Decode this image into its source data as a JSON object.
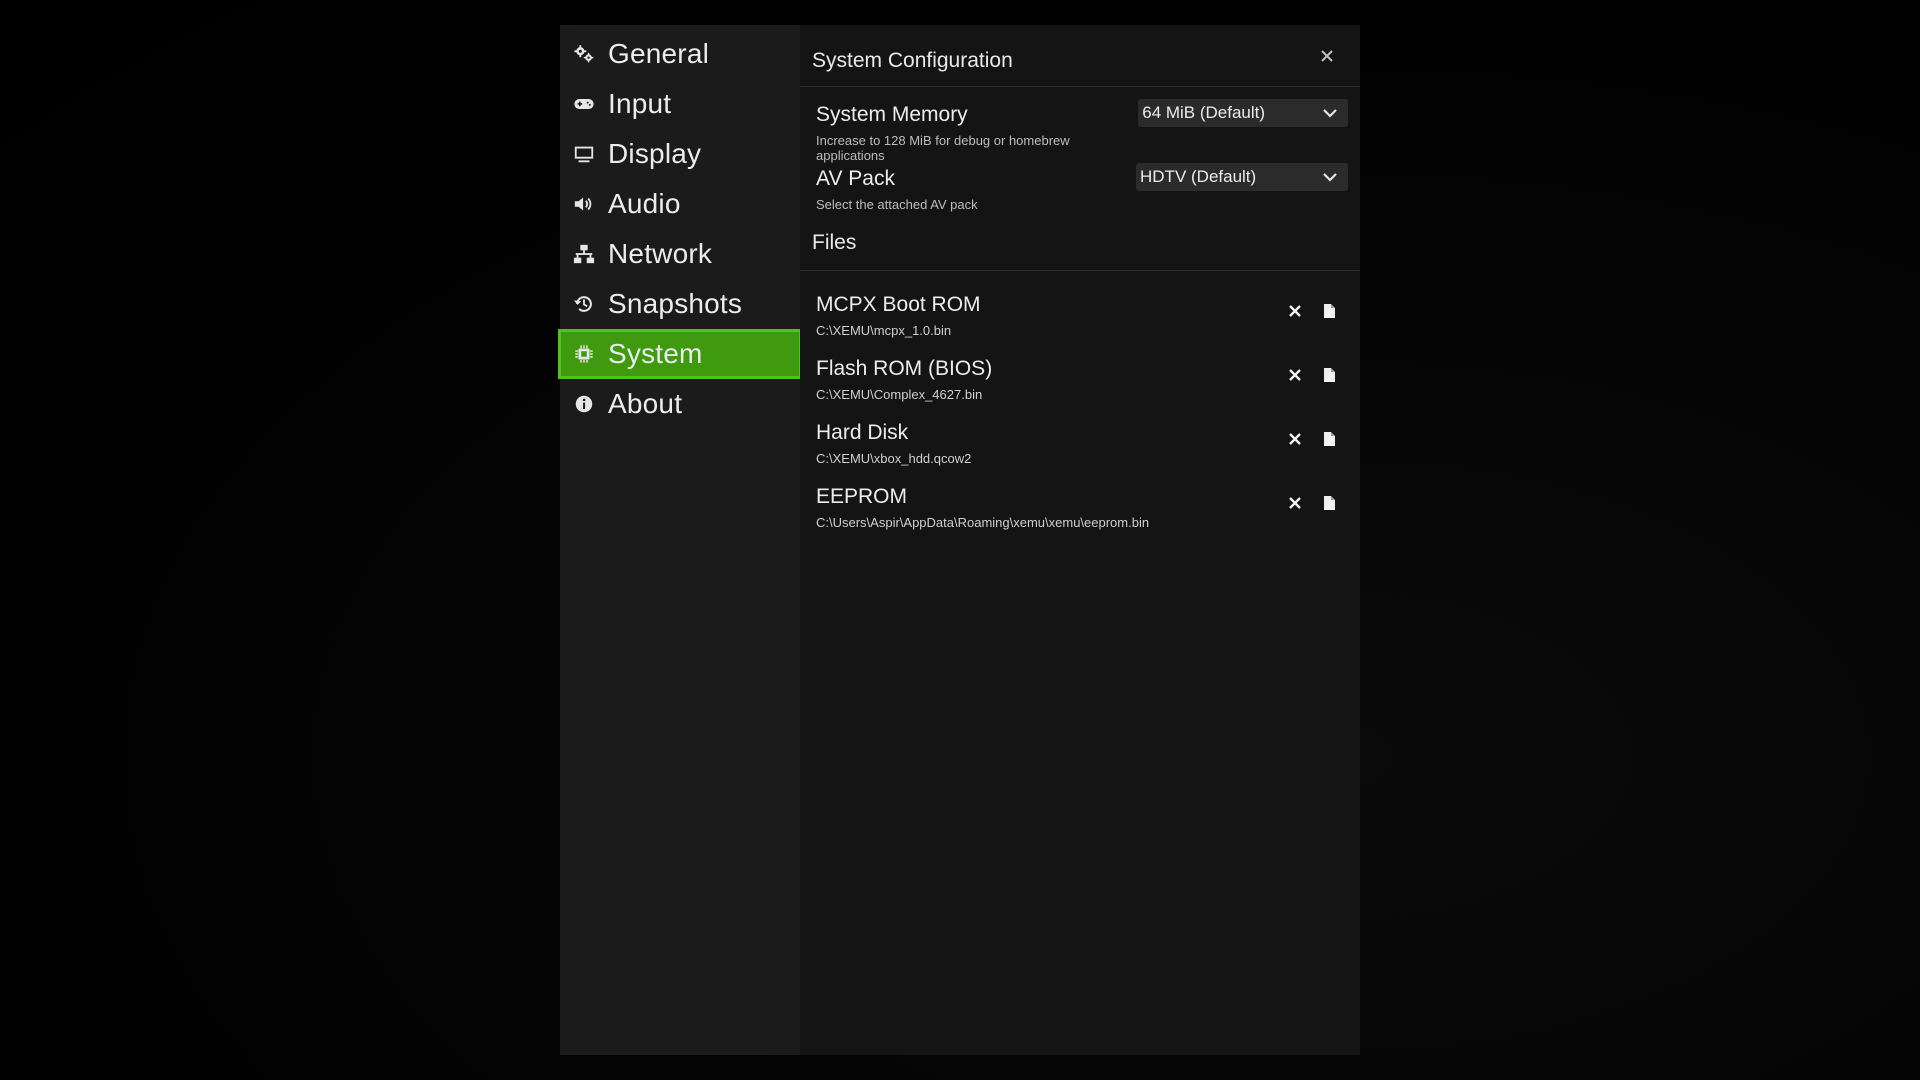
{
  "sidebar": {
    "items": [
      {
        "label": "General",
        "icon": "gears-icon"
      },
      {
        "label": "Input",
        "icon": "gamepad-icon"
      },
      {
        "label": "Display",
        "icon": "monitor-icon"
      },
      {
        "label": "Audio",
        "icon": "speaker-icon"
      },
      {
        "label": "Network",
        "icon": "network-icon"
      },
      {
        "label": "Snapshots",
        "icon": "history-icon"
      },
      {
        "label": "System",
        "icon": "chip-icon",
        "active": true
      },
      {
        "label": "About",
        "icon": "info-icon"
      }
    ]
  },
  "header": {
    "title": "System Configuration",
    "close_icon": "close-icon"
  },
  "settings": {
    "memory": {
      "name": "System Memory",
      "description": "Increase to 128 MiB for debug or homebrew applications",
      "value": "64 MiB (Default)"
    },
    "av_pack": {
      "name": "AV Pack",
      "description": "Select the attached AV pack",
      "value": "HDTV (Default)"
    }
  },
  "files": {
    "title": "Files",
    "items": [
      {
        "name": "MCPX Boot ROM",
        "path": "C:\\XEMU\\mcpx_1.0.bin"
      },
      {
        "name": "Flash ROM (BIOS)",
        "path": "C:\\XEMU\\Complex_4627.bin"
      },
      {
        "name": "Hard Disk",
        "path": "C:\\XEMU\\xbox_hdd.qcow2"
      },
      {
        "name": "EEPROM",
        "path": "C:\\Users\\Aspir\\AppData\\Roaming\\xemu\\xemu\\eeprom.bin"
      }
    ]
  },
  "colors": {
    "accent": "#3f9a0f",
    "accent_border": "#52c11c",
    "sidebar_bg": "#1b1b1b",
    "panel_bg": "#141414"
  }
}
